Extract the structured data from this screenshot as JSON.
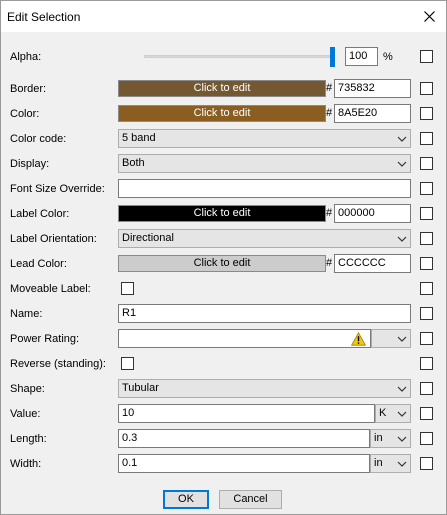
{
  "window": {
    "title": "Edit Selection"
  },
  "alpha": {
    "label": "Alpha:",
    "value": "100",
    "unit": "%",
    "level": 1.0
  },
  "border": {
    "label": "Border:",
    "button_label": "Click to edit",
    "hash": "#",
    "hex": "735832",
    "color": "#735832"
  },
  "color": {
    "label": "Color:",
    "button_label": "Click to edit",
    "hash": "#",
    "hex": "8A5E20",
    "color": "#8A5E20"
  },
  "color_code": {
    "label": "Color code:",
    "value": "5 band"
  },
  "display": {
    "label": "Display:",
    "value": "Both"
  },
  "font_size_override": {
    "label": "Font Size Override:",
    "value": ""
  },
  "label_color": {
    "label": "Label Color:",
    "button_label": "Click to edit",
    "hash": "#",
    "hex": "000000",
    "color": "#000000"
  },
  "label_orientation": {
    "label": "Label Orientation:",
    "value": "Directional"
  },
  "lead_color": {
    "label": "Lead Color:",
    "button_label": "Click to edit",
    "hash": "#",
    "hex": "CCCCCC",
    "color": "#CCCCCC"
  },
  "moveable_label": {
    "label": "Moveable Label:"
  },
  "name": {
    "label": "Name:",
    "value": "R1"
  },
  "power_rating": {
    "label": "Power Rating:",
    "value": "",
    "warning_icon": "warning-icon"
  },
  "reverse_standing": {
    "label": "Reverse (standing):"
  },
  "shape": {
    "label": "Shape:",
    "value": "Tubular"
  },
  "value": {
    "label": "Value:",
    "value": "10",
    "unit": "K"
  },
  "length": {
    "label": "Length:",
    "value": "0.3",
    "unit": "in"
  },
  "width": {
    "label": "Width:",
    "value": "0.1",
    "unit": "in"
  },
  "buttons": {
    "ok": "OK",
    "cancel": "Cancel"
  }
}
